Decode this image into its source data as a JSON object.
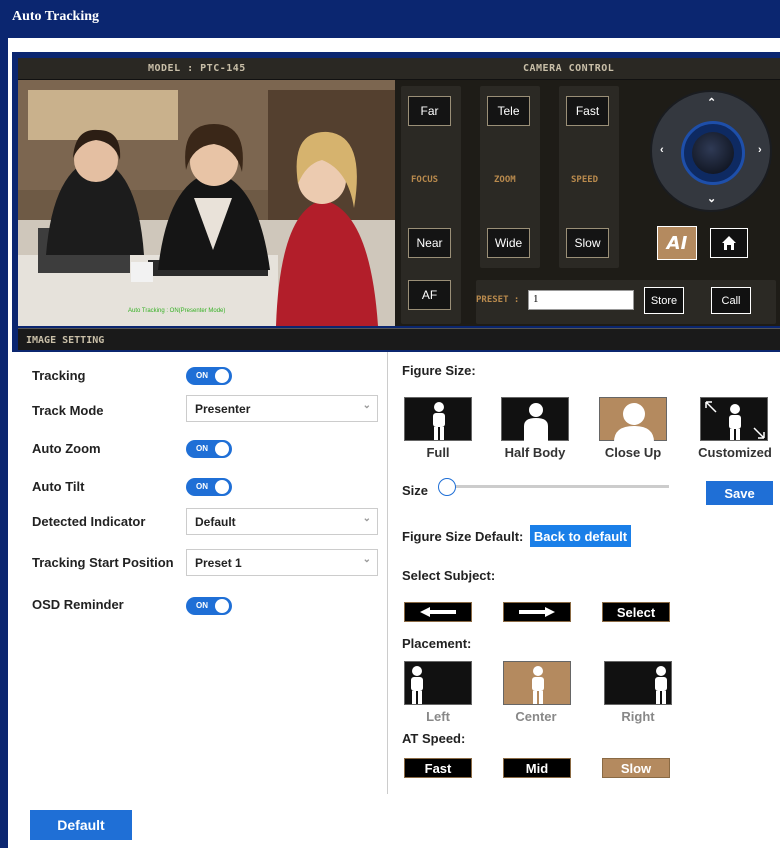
{
  "window": {
    "title": "Auto Tracking"
  },
  "camera": {
    "model_label": "MODEL : PTC-145",
    "control_label": "CAMERA CONTROL",
    "video_status": "Auto Tracking : ON(Presenter Mode)",
    "focus": {
      "far": "Far",
      "near": "Near",
      "label": "FOCUS"
    },
    "zoom": {
      "tele": "Tele",
      "wide": "Wide",
      "label": "ZOOM"
    },
    "speed": {
      "fast": "Fast",
      "slow": "Slow",
      "label": "SPEED"
    },
    "af": "AF",
    "preset_label": "PRESET :",
    "preset_value": "1",
    "store": "Store",
    "call": "Call",
    "ai_label": "AI"
  },
  "image_setting": {
    "title": "IMAGE SETTING",
    "toggle_on_text": "ON",
    "rows": {
      "tracking": {
        "label": "Tracking",
        "value": "ON"
      },
      "track_mode": {
        "label": "Track Mode",
        "value": "Presenter"
      },
      "auto_zoom": {
        "label": "Auto Zoom",
        "value": "ON"
      },
      "auto_tilt": {
        "label": "Auto Tilt",
        "value": "ON"
      },
      "detected_indicator": {
        "label": "Detected Indicator",
        "value": "Default"
      },
      "tracking_start_position": {
        "label": "Tracking Start Position",
        "value": "Preset 1"
      },
      "osd_reminder": {
        "label": "OSD Reminder",
        "value": "ON"
      }
    }
  },
  "figure": {
    "size_title": "Figure Size:",
    "options": [
      "Full",
      "Half Body",
      "Close Up",
      "Customized"
    ],
    "selected": "Close Up",
    "size_label": "Size",
    "size_value": 0,
    "save": "Save",
    "default_label": "Figure Size Default:",
    "back_to_default": "Back to default"
  },
  "subject": {
    "title": "Select Subject:",
    "select": "Select"
  },
  "placement": {
    "title": "Placement:",
    "options": [
      "Left",
      "Center",
      "Right"
    ],
    "selected": "Center"
  },
  "at_speed": {
    "title": "AT Speed:",
    "options": [
      "Fast",
      "Mid",
      "Slow"
    ],
    "selected": "Slow"
  },
  "footer": {
    "default_button": "Default"
  },
  "colors": {
    "accent": "#1f6fd6",
    "header": "#0b2670",
    "gold": "#b48a5f"
  }
}
